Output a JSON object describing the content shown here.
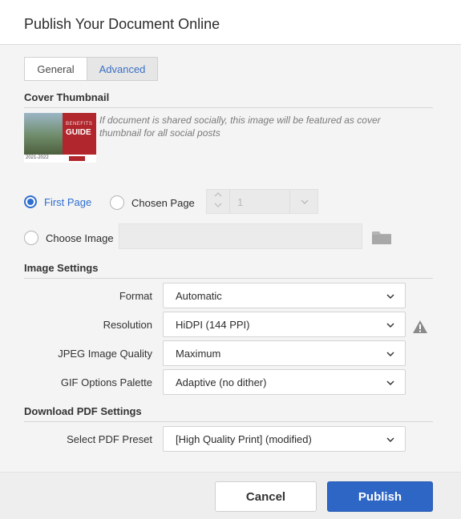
{
  "dialog": {
    "title": "Publish Your Document Online"
  },
  "tabs": [
    {
      "label": "General",
      "selected": false
    },
    {
      "label": "Advanced",
      "selected": true
    }
  ],
  "cover": {
    "section_title": "Cover Thumbnail",
    "note": "If document is shared socially, this image will be featured as cover thumbnail for all social posts",
    "thumbnail": {
      "line1": "BENEFITS",
      "line2": "GUIDE",
      "year": "2021-2022"
    },
    "first_page_label": "First Page",
    "chosen_page_label": "Chosen Page",
    "chosen_page_value": "1",
    "choose_image_label": "Choose Image",
    "selected_option": "First Page"
  },
  "image_settings": {
    "section_title": "Image Settings",
    "format_label": "Format",
    "format_value": "Automatic",
    "resolution_label": "Resolution",
    "resolution_value": "HiDPI (144 PPI)",
    "jpeg_quality_label": "JPEG Image Quality",
    "jpeg_quality_value": "Maximum",
    "gif_palette_label": "GIF Options Palette",
    "gif_palette_value": "Adaptive (no dither)"
  },
  "download_pdf": {
    "section_title": "Download PDF Settings",
    "preset_label": "Select PDF Preset",
    "preset_value": "[High Quality Print] (modified)"
  },
  "footer": {
    "cancel_label": "Cancel",
    "publish_label": "Publish"
  },
  "colors": {
    "accent": "#2e66c5",
    "active_text": "#2f6fd0",
    "warning": "#8a8a8a"
  },
  "icons": [
    "folder-icon",
    "warning-icon",
    "chevron-down-icon",
    "chevron-up-icon"
  ]
}
